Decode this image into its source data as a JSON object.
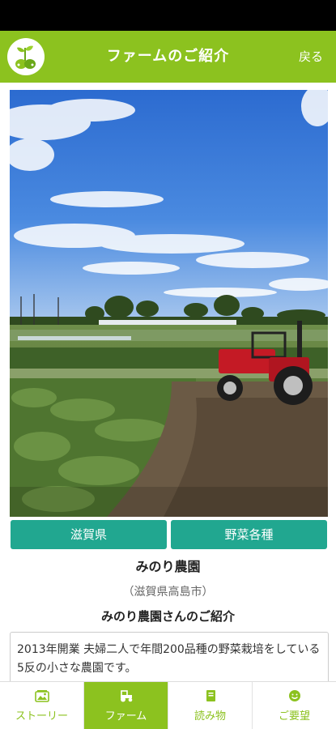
{
  "header": {
    "title": "ファームのご紹介",
    "back_label": "戻る",
    "logo_icon": "sprout-logo-icon"
  },
  "photo": {
    "subject": "farm-field-with-red-tractor"
  },
  "tags": [
    {
      "label": "滋賀県"
    },
    {
      "label": "野菜各種"
    }
  ],
  "farm": {
    "name": "みのり農園",
    "location": "（滋賀県高島市）",
    "intro_heading": "みのり農園さんのご紹介",
    "intro_text": "2013年開業 夫婦二人で年間200品種の野菜栽培をしている5反の小さな農園です。"
  },
  "nav": {
    "items": [
      {
        "label": "ストーリー",
        "icon": "photo-icon",
        "active": false
      },
      {
        "label": "ファーム",
        "icon": "tractor-icon",
        "active": true
      },
      {
        "label": "読み物",
        "icon": "book-icon",
        "active": false
      },
      {
        "label": "ご要望",
        "icon": "smile-icon",
        "active": false
      }
    ]
  },
  "colors": {
    "brand_green": "#8cc21f",
    "tag_teal": "#21a790"
  }
}
